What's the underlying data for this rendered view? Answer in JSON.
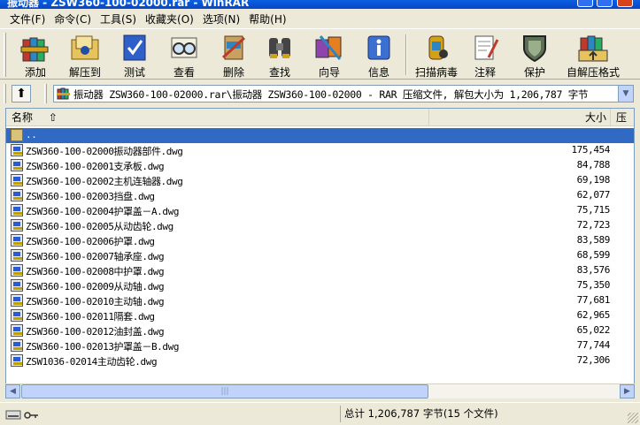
{
  "window": {
    "title": "振动器 - ZSW360-100-02000.rar - WinRAR",
    "controls": [
      "minimize",
      "maximize",
      "close"
    ]
  },
  "menu": [
    {
      "label": "文件(F)"
    },
    {
      "label": "命令(C)"
    },
    {
      "label": "工具(S)"
    },
    {
      "label": "收藏夹(O)"
    },
    {
      "label": "选项(N)"
    },
    {
      "label": "帮助(H)"
    }
  ],
  "toolbar": {
    "buttons": [
      {
        "label": "添加",
        "icon": "add-books-icon"
      },
      {
        "label": "解压到",
        "icon": "extract-folder-icon"
      },
      {
        "label": "测试",
        "icon": "test-check-icon"
      },
      {
        "label": "查看",
        "icon": "view-glasses-icon"
      },
      {
        "label": "删除",
        "icon": "delete-icon"
      },
      {
        "label": "查找",
        "icon": "find-binoculars-icon"
      },
      {
        "label": "向导",
        "icon": "wizard-icon"
      },
      {
        "label": "信息",
        "icon": "info-icon"
      },
      {
        "label": "扫描病毒",
        "icon": "virus-scan-icon"
      },
      {
        "label": "注释",
        "icon": "comment-icon"
      },
      {
        "label": "保护",
        "icon": "protect-shield-icon"
      },
      {
        "label": "自解压格式",
        "icon": "sfx-icon"
      }
    ]
  },
  "address": {
    "text": "振动器  ZSW360-100-02000.rar\\振动器  ZSW360-100-02000 - RAR 压缩文件, 解包大小为 1,206,787 字节"
  },
  "list": {
    "columns": {
      "name": "名称",
      "size": "大小",
      "packed": "压"
    },
    "parent": "..",
    "files": [
      {
        "name": "ZSW360-100-02000振动器部件.dwg",
        "size": "175,454"
      },
      {
        "name": "ZSW360-100-02001支承板.dwg",
        "size": "84,788"
      },
      {
        "name": "ZSW360-100-02002主机连轴器.dwg",
        "size": "69,198"
      },
      {
        "name": "ZSW360-100-02003挡盘.dwg",
        "size": "62,077"
      },
      {
        "name": "ZSW360-100-02004护罩盖－A.dwg",
        "size": "75,715"
      },
      {
        "name": "ZSW360-100-02005从动齿轮.dwg",
        "size": "72,723"
      },
      {
        "name": "ZSW360-100-02006护罩.dwg",
        "size": "83,589"
      },
      {
        "name": "ZSW360-100-02007轴承座.dwg",
        "size": "68,599"
      },
      {
        "name": "ZSW360-100-02008中护罩.dwg",
        "size": "83,576"
      },
      {
        "name": "ZSW360-100-02009从动轴.dwg",
        "size": "75,350"
      },
      {
        "name": "ZSW360-100-02010主动轴.dwg",
        "size": "77,681"
      },
      {
        "name": "ZSW360-100-02011隔套.dwg",
        "size": "62,965"
      },
      {
        "name": "ZSW360-100-02012油封盖.dwg",
        "size": "65,022"
      },
      {
        "name": "ZSW360-100-02013护罩盖－B.dwg",
        "size": "77,744"
      },
      {
        "name": "ZSW1036-02014主动齿轮.dwg",
        "size": "72,306"
      }
    ]
  },
  "status": {
    "text": "总计 1,206,787 字节(15 个文件)"
  },
  "colors": {
    "selection": "#316ac5",
    "titlebar": "#0a5fe0",
    "chrome": "#ece9d8"
  }
}
